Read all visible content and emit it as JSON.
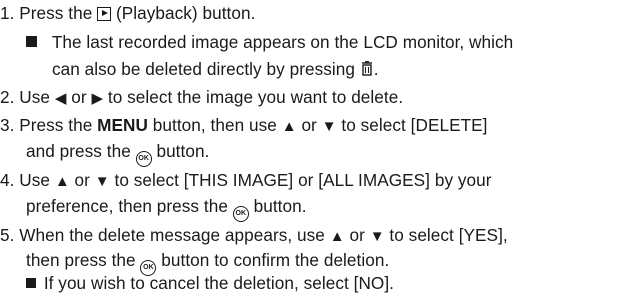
{
  "steps": [
    {
      "number": "1.",
      "parts": [
        "Press the",
        "(Playback) button."
      ],
      "note": [
        "The last recorded image appears on the LCD monitor, which",
        "can also be deleted directly by pressing",
        "."
      ]
    },
    {
      "number": "2.",
      "parts": [
        "Use",
        "or",
        "to select the image you want to delete."
      ]
    },
    {
      "number": "3.",
      "parts": [
        "Press the",
        "MENU",
        "button, then use",
        "or",
        "to select [DELETE]",
        "and press the",
        "button."
      ]
    },
    {
      "number": "4.",
      "parts": [
        "Use",
        "or",
        "to select [THIS IMAGE] or [ALL IMAGES] by your",
        "preference, then press the",
        "button."
      ]
    },
    {
      "number": "5.",
      "parts": [
        "When the delete message appears, use",
        "or",
        "to select [YES],",
        "then press the",
        "button to confirm the deletion."
      ],
      "note": [
        "If you wish to cancel the deletion, select [NO]."
      ]
    }
  ],
  "icons": {
    "left": "◀",
    "right": "▶",
    "up": "▲",
    "down": "▼",
    "ok": "OK"
  }
}
